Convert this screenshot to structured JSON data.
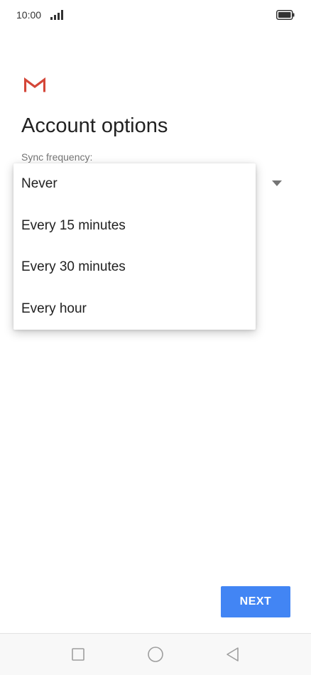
{
  "status_bar": {
    "time": "10:00",
    "signal_icon": "signal-bars-icon",
    "battery_icon": "battery-full-icon"
  },
  "app": {
    "logo_icon": "gmail-logo-icon"
  },
  "page": {
    "title": "Account options",
    "sync_label": "Sync frequency:"
  },
  "dropdown": {
    "options": [
      "Never",
      "Every 15 minutes",
      "Every 30 minutes",
      "Every hour"
    ]
  },
  "actions": {
    "next_label": "NEXT"
  },
  "nav_bar": {
    "icons": [
      "square-recent-apps-icon",
      "circle-home-icon",
      "triangle-back-icon"
    ]
  },
  "colors": {
    "accent": "#4285f4",
    "gmail_red": "#d44638"
  }
}
